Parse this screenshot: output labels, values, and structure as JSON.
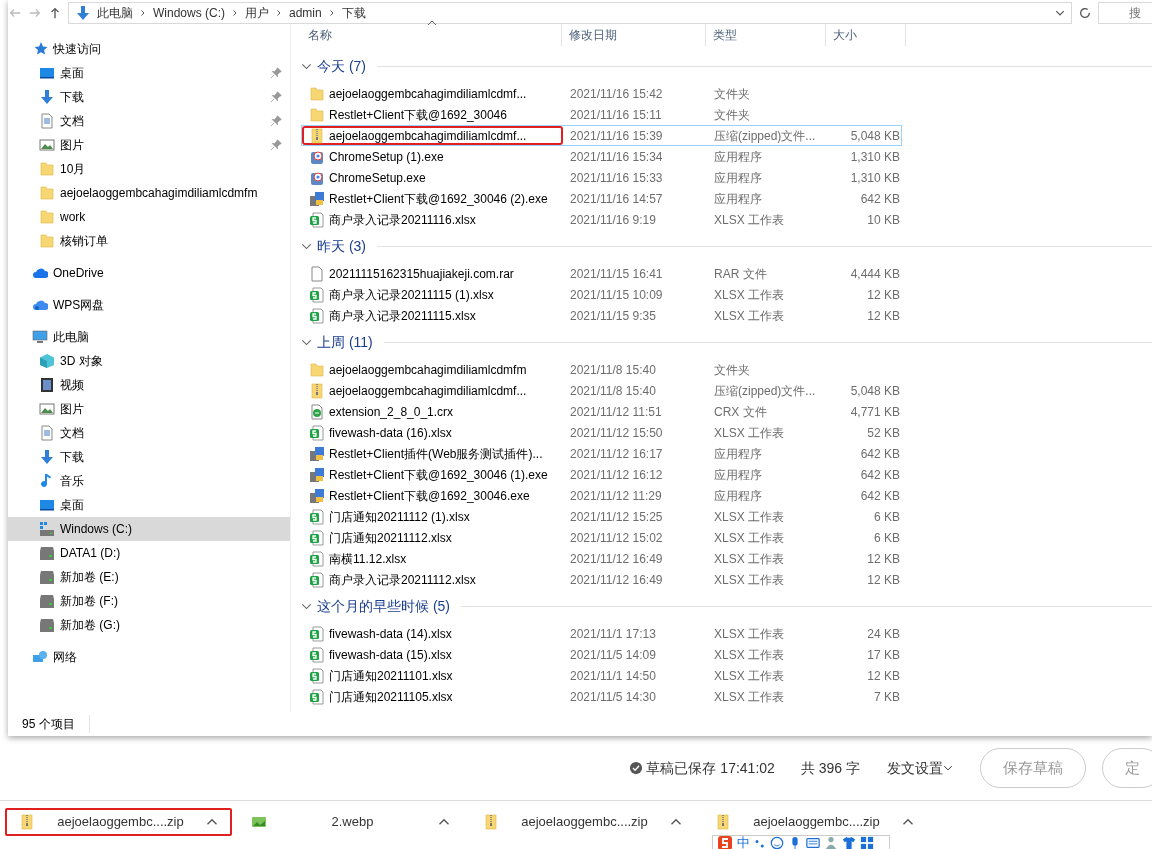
{
  "address_bar": {
    "path": [
      "此电脑",
      "Windows (C:)",
      "用户",
      "admin",
      "下载"
    ],
    "search_placeholder": "搜"
  },
  "columns": [
    "名称",
    "修改日期",
    "类型",
    "大小"
  ],
  "sidebar": [
    {
      "label": "快速访问",
      "kind": "star",
      "selected": false,
      "children": [
        {
          "label": "桌面",
          "kind": "desktop",
          "pinned": true,
          "selected": false
        },
        {
          "label": "下载",
          "kind": "download",
          "pinned": true,
          "selected": false
        },
        {
          "label": "文档",
          "kind": "document",
          "pinned": true,
          "selected": false
        },
        {
          "label": "图片",
          "kind": "picture",
          "pinned": true,
          "selected": false
        },
        {
          "label": "10月",
          "kind": "folder",
          "pinned": false,
          "selected": false
        },
        {
          "label": "aejoelaoggembcahagimdiliamlcdmfm",
          "kind": "folder",
          "pinned": false,
          "selected": false
        },
        {
          "label": "work",
          "kind": "folder",
          "pinned": false,
          "selected": false
        },
        {
          "label": "核销订单",
          "kind": "folder",
          "pinned": false,
          "selected": false
        }
      ]
    },
    {
      "label": "OneDrive",
      "kind": "cloud",
      "selected": false
    },
    {
      "label": "WPS网盘",
      "kind": "cloud2",
      "selected": false
    },
    {
      "label": "此电脑",
      "kind": "monitor",
      "selected": false,
      "children": [
        {
          "label": "3D 对象",
          "kind": "cube",
          "selected": false
        },
        {
          "label": "视频",
          "kind": "film",
          "selected": false
        },
        {
          "label": "图片",
          "kind": "picture",
          "selected": false
        },
        {
          "label": "文档",
          "kind": "document",
          "selected": false
        },
        {
          "label": "下载",
          "kind": "download",
          "selected": false
        },
        {
          "label": "音乐",
          "kind": "music",
          "selected": false
        },
        {
          "label": "桌面",
          "kind": "desktop",
          "selected": false
        },
        {
          "label": "Windows (C:)",
          "kind": "drive-os",
          "selected": true
        },
        {
          "label": "DATA1 (D:)",
          "kind": "drive",
          "selected": false
        },
        {
          "label": "新加卷 (E:)",
          "kind": "drive",
          "selected": false
        },
        {
          "label": "新加卷 (F:)",
          "kind": "drive",
          "selected": false
        },
        {
          "label": "新加卷 (G:)",
          "kind": "drive",
          "selected": false
        }
      ]
    },
    {
      "label": "网络",
      "kind": "network",
      "selected": false
    }
  ],
  "groups": [
    {
      "title": "今天 (7)",
      "rows": [
        {
          "name": "aejoelaoggembcahagimdiliamlcdmf...",
          "date": "2021/11/16 15:42",
          "type": "文件夹",
          "kind": "folder",
          "focused": false,
          "marked": false
        },
        {
          "name": "Restlet+Client下载@1692_30046",
          "date": "2021/11/16 15:11",
          "type": "文件夹",
          "kind": "folder",
          "focused": false,
          "marked": false
        },
        {
          "name": "aejoelaoggembcahagimdiliamlcdmf...",
          "date": "2021/11/16 15:39",
          "type": "压缩(zipped)文件...",
          "size": "5,048 KB",
          "kind": "zip",
          "focused": true,
          "marked": true
        },
        {
          "name": "ChromeSetup (1).exe",
          "date": "2021/11/16 15:34",
          "type": "应用程序",
          "size": "1,310 KB",
          "kind": "setup",
          "focused": false,
          "marked": false
        },
        {
          "name": "ChromeSetup.exe",
          "date": "2021/11/16 15:33",
          "type": "应用程序",
          "size": "1,310 KB",
          "kind": "setup",
          "focused": false,
          "marked": false
        },
        {
          "name": "Restlet+Client下载@1692_30046 (2).exe",
          "date": "2021/11/16 14:57",
          "type": "应用程序",
          "size": "642 KB",
          "kind": "installer",
          "focused": false,
          "marked": false
        },
        {
          "name": "商户录入记录20211116.xlsx",
          "date": "2021/11/16 9:19",
          "type": "XLSX 工作表",
          "size": "10 KB",
          "kind": "sheet",
          "focused": false,
          "marked": false
        }
      ]
    },
    {
      "title": "昨天 (3)",
      "rows": [
        {
          "name": "20211115162315huajiakeji.com.rar",
          "date": "2021/11/15 16:41",
          "type": "RAR 文件",
          "size": "4,444 KB",
          "kind": "file",
          "focused": false,
          "marked": false
        },
        {
          "name": "商户录入记录20211115 (1).xlsx",
          "date": "2021/11/15 10:09",
          "type": "XLSX 工作表",
          "size": "12 KB",
          "kind": "sheet",
          "focused": false,
          "marked": false
        },
        {
          "name": "商户录入记录20211115.xlsx",
          "date": "2021/11/15 9:35",
          "type": "XLSX 工作表",
          "size": "12 KB",
          "kind": "sheet",
          "focused": false,
          "marked": false
        }
      ]
    },
    {
      "title": "上周 (11)",
      "rows": [
        {
          "name": "aejoelaoggembcahagimdiliamlcdmfm",
          "date": "2021/11/8 15:40",
          "type": "文件夹",
          "kind": "folder",
          "focused": false,
          "marked": false
        },
        {
          "name": "aejoelaoggembcahagimdiliamlcdmf...",
          "date": "2021/11/8 15:40",
          "type": "压缩(zipped)文件...",
          "size": "5,048 KB",
          "kind": "zip",
          "focused": false,
          "marked": false
        },
        {
          "name": "extension_2_8_0_1.crx",
          "date": "2021/11/12 11:51",
          "type": "CRX 文件",
          "size": "4,771 KB",
          "kind": "crx",
          "focused": false,
          "marked": false
        },
        {
          "name": "fivewash-data (16).xlsx",
          "date": "2021/11/12 15:50",
          "type": "XLSX 工作表",
          "size": "52 KB",
          "kind": "sheet",
          "focused": false,
          "marked": false
        },
        {
          "name": "Restlet+Client插件(Web服务测试插件)...",
          "date": "2021/11/12 16:17",
          "type": "应用程序",
          "size": "642 KB",
          "kind": "installer",
          "focused": false,
          "marked": false
        },
        {
          "name": "Restlet+Client下载@1692_30046 (1).exe",
          "date": "2021/11/12 16:12",
          "type": "应用程序",
          "size": "642 KB",
          "kind": "installer",
          "focused": false,
          "marked": false
        },
        {
          "name": "Restlet+Client下载@1692_30046.exe",
          "date": "2021/11/12 11:29",
          "type": "应用程序",
          "size": "642 KB",
          "kind": "installer",
          "focused": false,
          "marked": false
        },
        {
          "name": "门店通知20211112 (1).xlsx",
          "date": "2021/11/12 15:25",
          "type": "XLSX 工作表",
          "size": "6 KB",
          "kind": "sheet",
          "focused": false,
          "marked": false
        },
        {
          "name": "门店通知20211112.xlsx",
          "date": "2021/11/12 15:02",
          "type": "XLSX 工作表",
          "size": "6 KB",
          "kind": "sheet",
          "focused": false,
          "marked": false
        },
        {
          "name": "南横11.12.xlsx",
          "date": "2021/11/12 16:49",
          "type": "XLSX 工作表",
          "size": "12 KB",
          "kind": "sheet",
          "focused": false,
          "marked": false
        },
        {
          "name": "商户录入记录20211112.xlsx",
          "date": "2021/11/12 16:49",
          "type": "XLSX 工作表",
          "size": "12 KB",
          "kind": "sheet",
          "focused": false,
          "marked": false
        }
      ]
    },
    {
      "title": "这个月的早些时候 (5)",
      "rows": [
        {
          "name": "fivewash-data (14).xlsx",
          "date": "2021/11/1 17:13",
          "type": "XLSX 工作表",
          "size": "24 KB",
          "kind": "sheet",
          "focused": false,
          "marked": false
        },
        {
          "name": "fivewash-data (15).xlsx",
          "date": "2021/11/5 14:09",
          "type": "XLSX 工作表",
          "size": "17 KB",
          "kind": "sheet",
          "focused": false,
          "marked": false
        },
        {
          "name": "门店通知20211101.xlsx",
          "date": "2021/11/1 14:50",
          "type": "XLSX 工作表",
          "size": "12 KB",
          "kind": "sheet",
          "focused": false,
          "marked": false
        },
        {
          "name": "门店通知20211105.xlsx",
          "date": "2021/11/5 14:30",
          "type": "XLSX 工作表",
          "size": "7 KB",
          "kind": "sheet",
          "focused": false,
          "marked": false
        }
      ]
    }
  ],
  "status_bar": "95 个项目",
  "editor_footer": {
    "saved": "草稿已保存 17:41:02",
    "word_count": "共 396 字",
    "publish_settings": "发文设置",
    "buttons": [
      "保存草稿",
      "定"
    ]
  },
  "downloads": [
    {
      "name": "aejoelaoggembc....zip",
      "kind": "zip",
      "marked": true
    },
    {
      "name": "2.webp",
      "kind": "pic",
      "marked": false
    },
    {
      "name": "aejoelaoggembc....zip",
      "kind": "zip",
      "marked": false
    },
    {
      "name": "aejoelaoggembc....zip",
      "kind": "zip",
      "marked": false
    }
  ],
  "ime_toolbar": {
    "mode": "中"
  }
}
